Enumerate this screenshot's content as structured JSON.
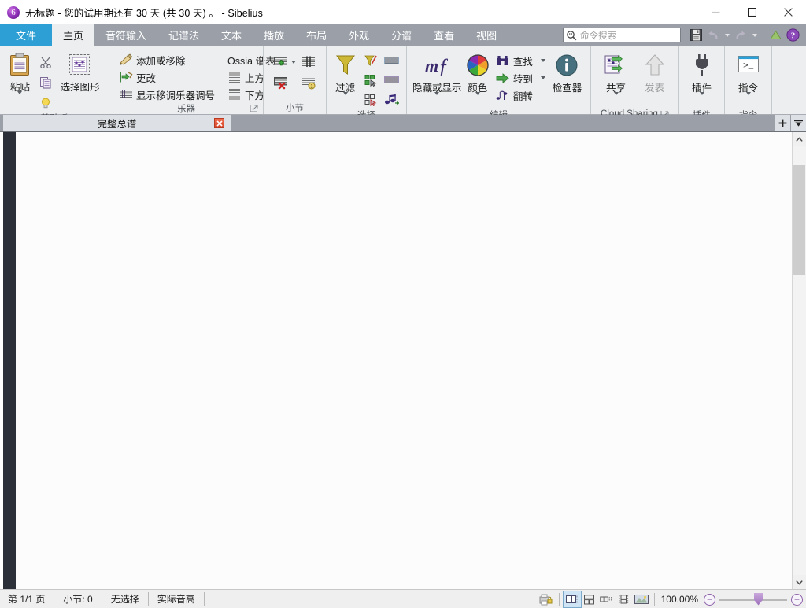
{
  "window": {
    "app_icon": "sibelius-logo-icon",
    "title": "无标题 - 您的试用期还有 30 天 (共 30 天) 。 - Sibelius",
    "minimize_label": "最小化",
    "maximize_label": "最大化",
    "close_label": "关闭"
  },
  "ribbon_tabs": [
    {
      "id": "file",
      "label": "文件",
      "state": "file"
    },
    {
      "id": "home",
      "label": "主页",
      "state": "active"
    },
    {
      "id": "note",
      "label": "音符输入",
      "state": "normal"
    },
    {
      "id": "notation",
      "label": "记谱法",
      "state": "normal"
    },
    {
      "id": "text",
      "label": "文本",
      "state": "normal"
    },
    {
      "id": "play",
      "label": "播放",
      "state": "normal"
    },
    {
      "id": "layout",
      "label": "布局",
      "state": "normal"
    },
    {
      "id": "appear",
      "label": "外观",
      "state": "normal"
    },
    {
      "id": "parts",
      "label": "分谱",
      "state": "normal"
    },
    {
      "id": "review",
      "label": "查看",
      "state": "normal"
    },
    {
      "id": "view",
      "label": "视图",
      "state": "normal"
    }
  ],
  "quick_access": {
    "search_placeholder": "命令搜索",
    "search_value": "",
    "search_icon": "search-icon",
    "save_icon": "save-floppy-icon",
    "undo_icon": "undo-arrow-icon",
    "undo_caret_icon": "chevron-down-icon",
    "redo_icon": "redo-arrow-icon",
    "redo_caret_icon": "chevron-down-icon",
    "update_icon": "green-triangle-icon",
    "help_icon": "purple-question-help-icon"
  },
  "ribbon_groups": [
    {
      "id": "clipboard",
      "title": "剪贴板",
      "big": {
        "label": "粘贴",
        "icon": "clipboard-paste-icon",
        "has_caret": true
      },
      "small_icons": [
        {
          "label": "剪切",
          "icon": "scissors-cut-icon"
        },
        {
          "label": "复制",
          "icon": "copy-pages-icon"
        },
        {
          "label": "提示",
          "icon": "lightbulb-idea-icon"
        }
      ],
      "big2": {
        "label": "选择图形",
        "icon": "graphic-select-icon"
      }
    },
    {
      "id": "instruments",
      "title": "乐器",
      "has_dialog_launcher": true,
      "col1": [
        {
          "label": "添加或移除",
          "icon": "add-remove-instrument-icon"
        },
        {
          "label": "更改",
          "icon": "change-instrument-icon"
        },
        {
          "label": "显示移调乐器调号",
          "icon": "transposing-key-icon"
        }
      ],
      "col2": [
        {
          "label": "Ossia 谱表",
          "icon": "ossia-staff-icon"
        },
        {
          "label": "上方",
          "icon": "staff-above-icon"
        },
        {
          "label": "下方",
          "icon": "staff-below-icon"
        }
      ]
    },
    {
      "id": "bars",
      "title": "小节",
      "icons": [
        {
          "label": "添加小节",
          "icon": "add-bar-icon",
          "has_caret": true
        },
        {
          "label": "拆分小节",
          "icon": "split-bar-icon"
        },
        {
          "label": "删除小节",
          "icon": "delete-bar-icon"
        },
        {
          "label": "小节编号",
          "icon": "bar-number-icon"
        }
      ]
    },
    {
      "id": "select",
      "title": "选择",
      "big": {
        "label": "过滤",
        "icon": "filter-funnel-icon",
        "has_caret": true
      },
      "icons": [
        {
          "label": "高级过滤",
          "icon": "filter-advanced-icon"
        },
        {
          "label": "选择所有谱表",
          "icon": "select-all-staves-icon"
        },
        {
          "label": "选择对象",
          "icon": "select-object-icon"
        },
        {
          "label": "选择段落",
          "icon": "select-passage-icon"
        },
        {
          "label": "选择系统",
          "icon": "select-system-icon"
        },
        {
          "label": "选择音符",
          "icon": "select-notes-icon"
        }
      ]
    },
    {
      "id": "edit",
      "title": "编辑",
      "big1": {
        "label": "隐藏或显示",
        "icon": "hide-show-icon",
        "has_caret": true
      },
      "big2": {
        "label": "颜色",
        "icon": "color-wheel-icon",
        "has_caret": true
      },
      "col": [
        {
          "label": "查找",
          "icon": "find-binoculars-icon",
          "has_caret": true
        },
        {
          "label": "转到",
          "icon": "goto-green-arrow-icon",
          "has_caret": true
        },
        {
          "label": "翻转",
          "icon": "flip-icon",
          "has_caret": false
        }
      ],
      "big3": {
        "label": "检查器",
        "icon": "inspector-info-icon"
      }
    },
    {
      "id": "cloud",
      "title": "Cloud Sharing",
      "has_dialog_launcher": true,
      "buttons": [
        {
          "label": "共享",
          "icon": "share-cloud-icon",
          "has_caret": true,
          "disabled": false
        },
        {
          "label": "发表",
          "icon": "publish-up-arrow-icon",
          "has_caret": false,
          "disabled": true
        }
      ]
    },
    {
      "id": "plugins",
      "title": "插件",
      "buttons": [
        {
          "label": "插件",
          "icon": "plugin-plug-icon",
          "has_caret": true
        }
      ]
    },
    {
      "id": "command",
      "title": "指令",
      "buttons": [
        {
          "label": "指令",
          "icon": "command-console-icon",
          "has_caret": true
        }
      ]
    }
  ],
  "document_tabs": {
    "tabs": [
      {
        "label": "完整总谱",
        "close_icon": "close-x-icon",
        "active": true
      }
    ],
    "new_tab_icon": "plus-icon",
    "tab_list_icon": "tab-dropdown-icon"
  },
  "score": {
    "page_background": "#fcfcfc",
    "backdrop_color": "#2c3038"
  },
  "scrollbar": {
    "up_icon": "chevron-up-icon",
    "down_icon": "chevron-down-icon"
  },
  "statusbar": {
    "cells": [
      {
        "id": "page",
        "label": "第 1/1 页"
      },
      {
        "id": "bar",
        "label": "小节: 0"
      },
      {
        "id": "selection",
        "label": "无选择"
      },
      {
        "id": "pitch",
        "label": "实际音高"
      }
    ],
    "lock_icon": "print-lock-icon",
    "view_icons": [
      {
        "id": "panorama",
        "icon": "view-single-page-icon",
        "selected": true
      },
      {
        "id": "spreads-horiz",
        "icon": "view-spreads-icon",
        "selected": false
      },
      {
        "id": "pages-horiz",
        "icon": "view-pages-row-icon",
        "selected": false
      },
      {
        "id": "pages-vert",
        "icon": "view-pages-column-icon",
        "selected": false
      },
      {
        "id": "panorama-view",
        "icon": "view-panorama-icon",
        "selected": false
      }
    ],
    "zoom_value": "100.00%",
    "zoom_out_icon": "minus-circle-icon",
    "zoom_in_icon": "plus-circle-icon",
    "zoom_slider_percent": 50
  },
  "colors": {
    "accent_blue": "#2e9fd4",
    "tabbar_gray": "#9ba0a8",
    "ribbon_bg": "#eceef0",
    "close_red": "#d9472a",
    "backdrop": "#2c3038"
  }
}
